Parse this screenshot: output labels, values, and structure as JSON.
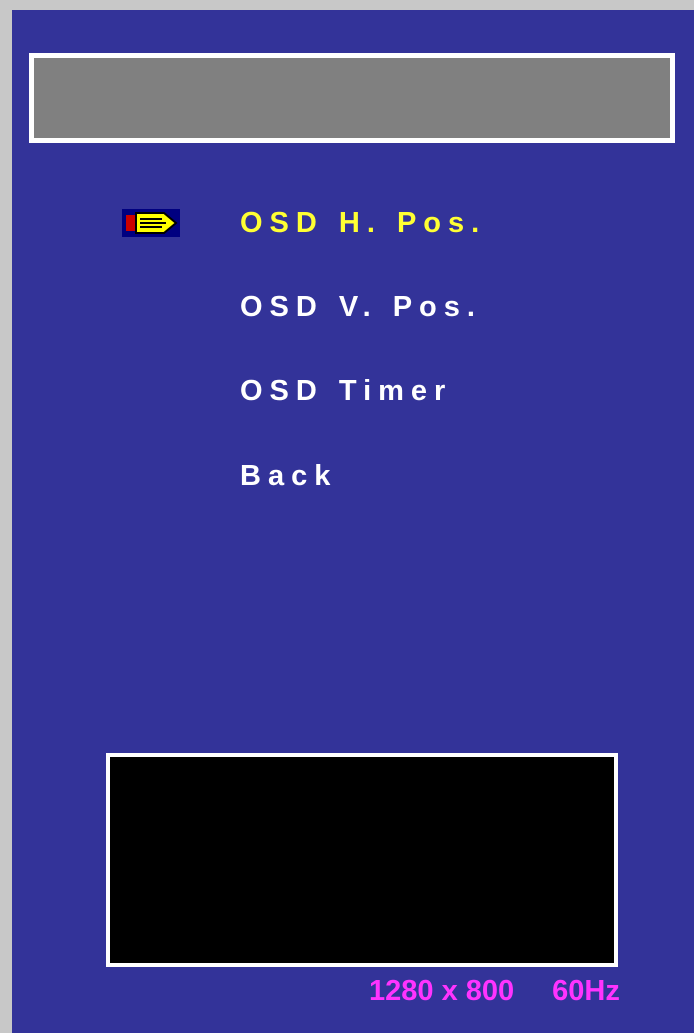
{
  "title_bar": {
    "label": ""
  },
  "menu": {
    "selected_index": 0,
    "items": [
      {
        "label": "OSD H. Pos."
      },
      {
        "label": "OSD V. Pos."
      },
      {
        "label": "OSD Timer"
      },
      {
        "label": "Back"
      }
    ]
  },
  "selector_icon": {
    "name": "pencil-pointer-icon"
  },
  "status": {
    "resolution": "1280 x 800",
    "refresh_rate": "60Hz"
  },
  "colors": {
    "panel_background": "#333399",
    "frame_background": "#c8c8c8",
    "title_bar_fill": "#808080",
    "selected_text": "#ffff33",
    "normal_text": "#ffffff",
    "status_text": "#ff33ff",
    "preview_fill": "#000000"
  }
}
